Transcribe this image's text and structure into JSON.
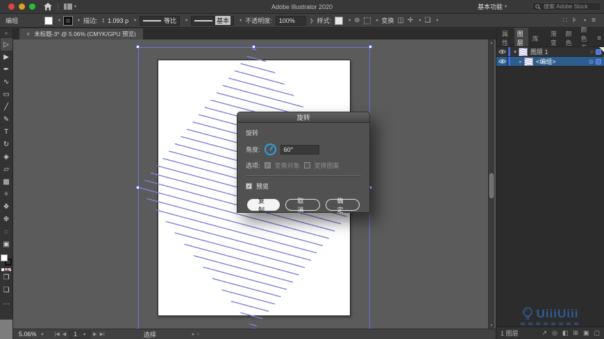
{
  "app": {
    "title": "Adobe Illustrator 2020",
    "workspace": "基本功能",
    "search_placeholder": "搜索 Adobe Stock"
  },
  "control_bar": {
    "selection_label": "编组",
    "stroke_label": "描边:",
    "stroke_value": "1.093 p",
    "profile_value": "等比",
    "brush_value": "基本",
    "opacity_label": "不透明度:",
    "opacity_value": "100%",
    "style_label": "样式:",
    "transform_label": "变换"
  },
  "doc_tab": {
    "title": "未标题-3* @ 5.06% (CMYK/GPU 预览)"
  },
  "tools": [
    {
      "name": "selection-tool",
      "glyph": "▷"
    },
    {
      "name": "direct-selection-tool",
      "glyph": "▶"
    },
    {
      "name": "pen-tool",
      "glyph": "✒"
    },
    {
      "name": "curvature-tool",
      "glyph": "∿"
    },
    {
      "name": "rectangle-tool",
      "glyph": "▭"
    },
    {
      "name": "line-segment-tool",
      "glyph": "╱"
    },
    {
      "name": "paintbrush-tool",
      "glyph": "✎"
    },
    {
      "name": "type-tool",
      "glyph": "T"
    },
    {
      "name": "rotate-tool",
      "glyph": "↻"
    },
    {
      "name": "eraser-tool",
      "glyph": "◈"
    },
    {
      "name": "free-transform-tool",
      "glyph": "▱"
    },
    {
      "name": "gradient-tool",
      "glyph": "▩"
    },
    {
      "name": "eyedropper-tool",
      "glyph": "✧"
    },
    {
      "name": "blend-tool",
      "glyph": "❖"
    },
    {
      "name": "symbol-sprayer-tool",
      "glyph": "❉"
    },
    {
      "name": "zoom-tool",
      "glyph": "◌"
    },
    {
      "name": "artboard-tool",
      "glyph": "▣"
    }
  ],
  "dialog": {
    "title": "旋转",
    "section_label": "旋转",
    "angle_label": "角度:",
    "angle_value": "60°",
    "options_label": "选项:",
    "option_objects": "变换对象",
    "option_patterns": "变换图案",
    "preview_label": "预览",
    "copy_label": "复制",
    "cancel_label": "取消",
    "ok_label": "确定"
  },
  "panel": {
    "tabs_left": [
      {
        "label": "属性"
      },
      {
        "label": "图层"
      },
      {
        "label": "库"
      }
    ],
    "tabs_right": [
      {
        "label": "渐变"
      },
      {
        "label": "颜色"
      },
      {
        "label": "颜色参"
      }
    ],
    "rows": [
      {
        "name": "图层 1"
      },
      {
        "name": "<编组>"
      }
    ],
    "footer_count": "1 图层",
    "footer_icons": [
      {
        "name": "collect-for-export-icon",
        "glyph": "↗"
      },
      {
        "name": "locate-object-icon",
        "glyph": "◎"
      },
      {
        "name": "clipping-mask-icon",
        "glyph": "◧"
      },
      {
        "name": "new-sublayer-icon",
        "glyph": "⊞"
      },
      {
        "name": "new-layer-icon",
        "glyph": "▣"
      },
      {
        "name": "delete-selection-icon",
        "glyph": "▢"
      }
    ]
  },
  "status": {
    "zoom": "5.06%",
    "artboard": "1",
    "tool": "选择"
  },
  "watermark": {
    "text": "UiiiUiii"
  },
  "colors": {
    "hatch_blue": "#7e83d9",
    "selection_blue": "#6b74dd",
    "dial_blue": "#2fa3e8",
    "selected_row_blue": "#2d5d8c",
    "layer_color": "#3f6fd8"
  }
}
